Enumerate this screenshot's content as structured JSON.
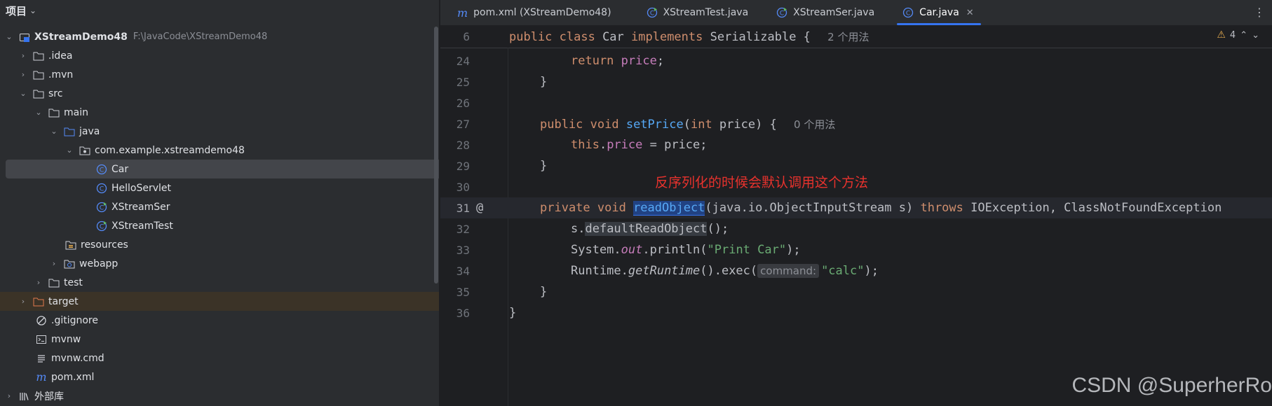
{
  "sidebar": {
    "title": "项目",
    "tree": [
      {
        "label": "XStreamDemo48",
        "path": "F:\\JavaCode\\XStreamDemo48",
        "icon": "module-icon"
      },
      {
        "label": ".idea",
        "icon": "folder-icon"
      },
      {
        "label": ".mvn",
        "icon": "folder-icon"
      },
      {
        "label": "src",
        "icon": "folder-icon"
      },
      {
        "label": "main",
        "icon": "folder-icon"
      },
      {
        "label": "java",
        "icon": "source-folder-icon"
      },
      {
        "label": "com.example.xstreamdemo48",
        "icon": "package-icon"
      },
      {
        "label": "Car",
        "icon": "class-icon"
      },
      {
        "label": "HelloServlet",
        "icon": "class-icon"
      },
      {
        "label": "XStreamSer",
        "icon": "runnable-class-icon"
      },
      {
        "label": "XStreamTest",
        "icon": "runnable-class-icon"
      },
      {
        "label": "resources",
        "icon": "resources-folder-icon"
      },
      {
        "label": "webapp",
        "icon": "web-folder-icon"
      },
      {
        "label": "test",
        "icon": "folder-icon"
      },
      {
        "label": "target",
        "icon": "excluded-folder-icon"
      },
      {
        "label": ".gitignore",
        "icon": "ignore-file-icon"
      },
      {
        "label": "mvnw",
        "icon": "terminal-file-icon"
      },
      {
        "label": "mvnw.cmd",
        "icon": "text-file-icon"
      },
      {
        "label": "pom.xml",
        "icon": "maven-icon"
      },
      {
        "label": "外部库",
        "icon": "library-icon"
      }
    ]
  },
  "tabs": [
    {
      "label": "pom.xml (XStreamDemo48)",
      "icon": "maven-icon"
    },
    {
      "label": "XStreamTest.java",
      "icon": "runnable-class-icon"
    },
    {
      "label": "XStreamSer.java",
      "icon": "runnable-class-icon"
    },
    {
      "label": "Car.java",
      "icon": "class-icon",
      "active": true
    }
  ],
  "editor": {
    "sticky_line": {
      "number": "6",
      "kw1": "public class ",
      "name": "Car ",
      "kw2": "implements ",
      "rest": "Serializable { ",
      "hint": "2 个用法"
    },
    "warnings": "4",
    "lines": [
      {
        "n": "24"
      },
      {
        "n": "25"
      },
      {
        "n": "26"
      },
      {
        "n": "27"
      },
      {
        "n": "28"
      },
      {
        "n": "29"
      },
      {
        "n": "30"
      },
      {
        "n": "31"
      },
      {
        "n": "32"
      },
      {
        "n": "33"
      },
      {
        "n": "34"
      },
      {
        "n": "35"
      },
      {
        "n": "36"
      }
    ],
    "l24": {
      "kw": "return ",
      "fld": "price",
      "rest": ";"
    },
    "l25": "}",
    "l27": {
      "kw": "public void ",
      "fn": "setPrice",
      "p1": "(",
      "kw2": "int ",
      "p2": "price) { ",
      "hint": "0 个用法"
    },
    "l28": {
      "kw": "this",
      "dot": ".",
      "fld": "price",
      "rest": " = price;"
    },
    "l29": "}",
    "l31": {
      "kw": "private void ",
      "fn": "readObject",
      "p1": "(java.io.ObjectInputStream s) ",
      "kw2": "throws ",
      "rest": "IOException, ClassNotFoundException"
    },
    "l32": {
      "a": "s.",
      "b": "defaultReadObject",
      "c": "();"
    },
    "l33": {
      "a": "System.",
      "fld": "out",
      "b": ".println(",
      "str": "\"Print Car\"",
      "c": ");"
    },
    "l34": {
      "a": "Runtime.",
      "it": "getRuntime",
      "b": "().exec(",
      "pill": "command:",
      "str": "\"calc\"",
      "c": ");"
    },
    "l35": "}",
    "l36": "}"
  },
  "annotation": "反序列化的时候会默认调用这个方法",
  "watermark": "CSDN @SuperherRo",
  "colors": {
    "accent": "#3574f0",
    "annotation": "#e8322d",
    "keyword": "#cf8e6d",
    "method": "#56a8f5",
    "field": "#c77dbb",
    "string": "#6aab73"
  }
}
